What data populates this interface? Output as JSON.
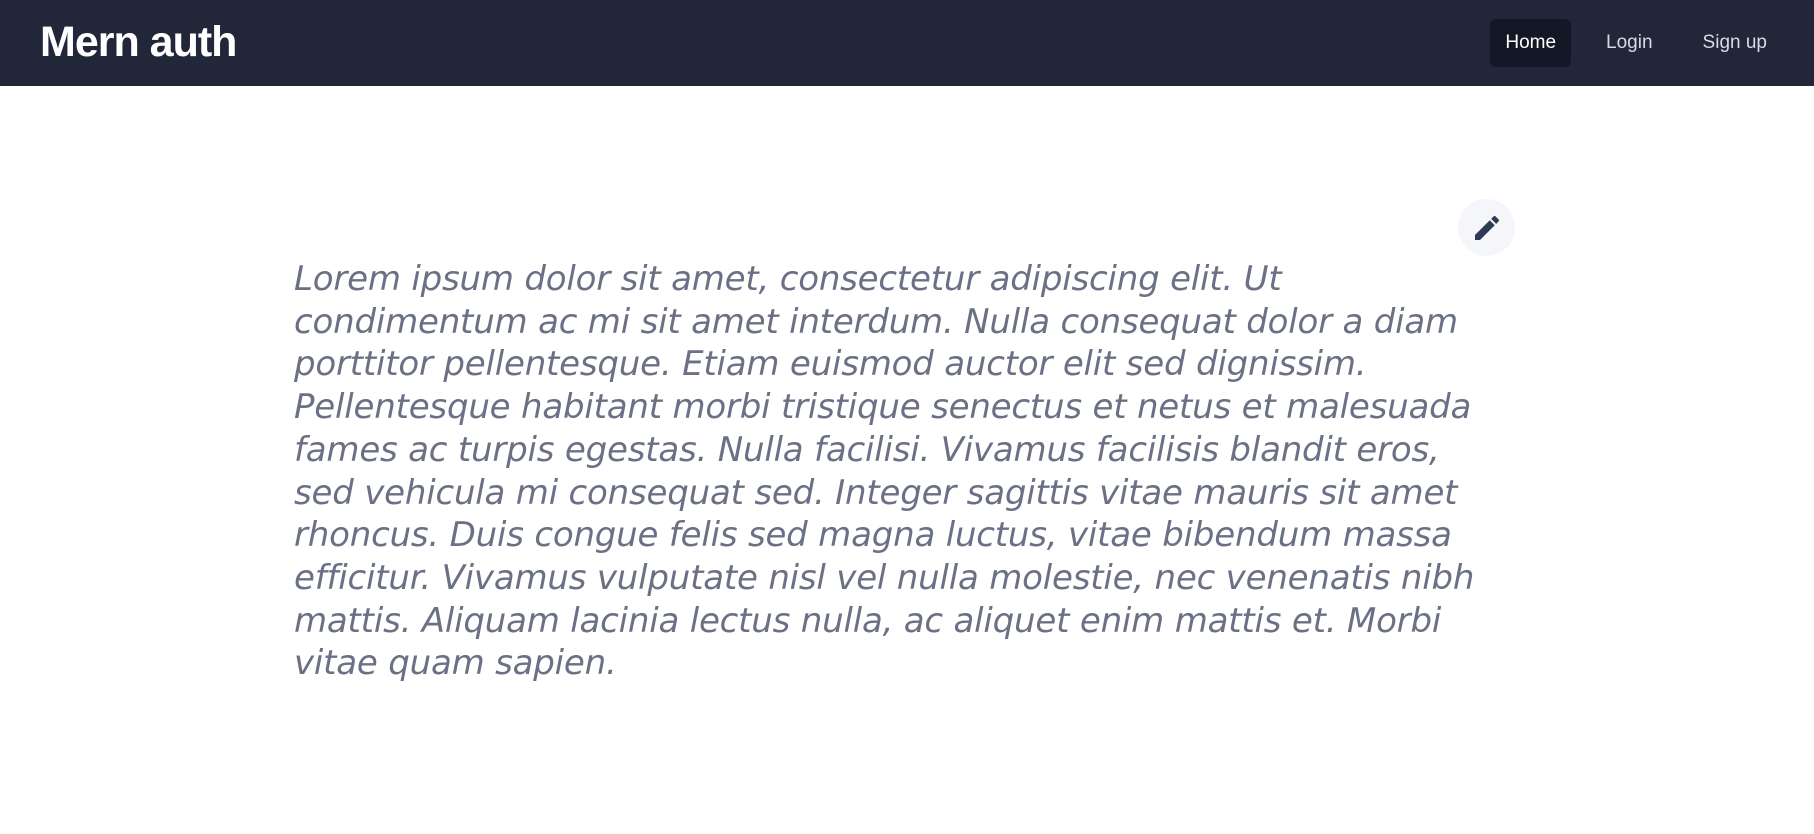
{
  "header": {
    "brand": "Mern auth",
    "nav": [
      {
        "label": "Home",
        "active": true
      },
      {
        "label": "Login",
        "active": false
      },
      {
        "label": "Sign up",
        "active": false
      }
    ]
  },
  "main": {
    "edit_icon": "pencil-icon",
    "paragraph": "Lorem ipsum dolor sit amet, consectetur adipiscing elit. Ut condimentum ac mi sit amet interdum. Nulla consequat dolor a diam porttitor pellentesque. Etiam euismod auctor elit sed dignissim. Pellentesque habitant morbi tristique senectus et netus et malesuada fames ac turpis egestas. Nulla facilisi. Vivamus facilisis blandit eros, sed vehicula mi consequat sed. Integer sagittis vitae mauris sit amet rhoncus. Duis congue felis sed magna luctus, vitae bibendum massa efficitur. Vivamus vulputate nisl vel nulla molestie, nec venenatis nibh mattis. Aliquam lacinia lectus nulla, ac aliquet enim mattis et. Morbi vitae quam sapien."
  },
  "colors": {
    "navbar_bg": "#212639",
    "active_nav_bg": "#141826",
    "text_muted": "#6b7085",
    "icon": "#2f3a55"
  }
}
